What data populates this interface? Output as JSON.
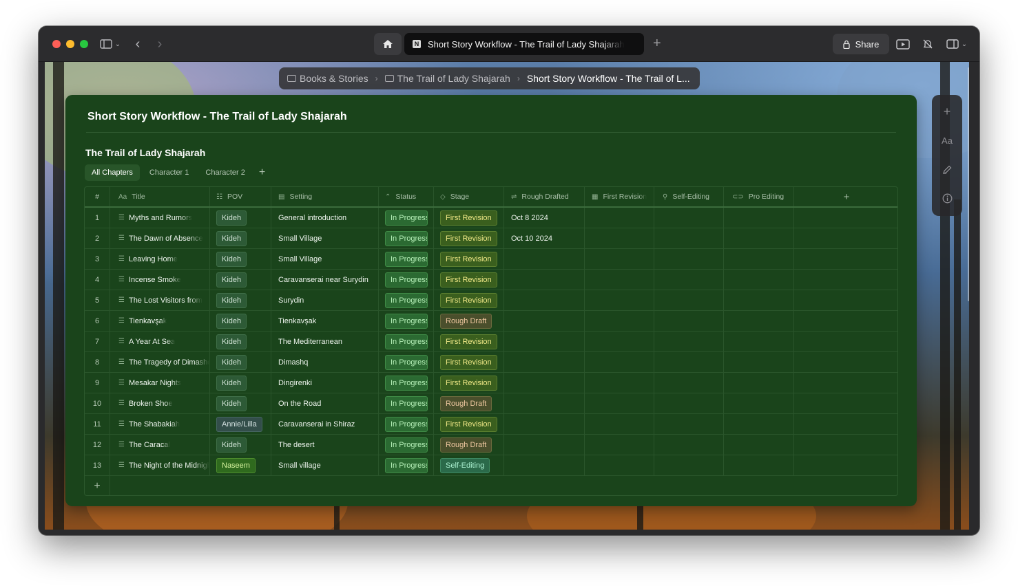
{
  "browser": {
    "tab_title": "Short Story Workflow - The Trail of Lady Shajarah",
    "share_label": "Share"
  },
  "breadcrumb": [
    "Books & Stories",
    "The Trail of Lady Shajarah",
    "Short Story Workflow - The Trail of L..."
  ],
  "page": {
    "title": "Short Story Workflow - The Trail of Lady Shajarah",
    "database_title": "The Trail of Lady Shajarah"
  },
  "views": [
    "All Chapters",
    "Character 1",
    "Character 2"
  ],
  "columns": {
    "num": "#",
    "title": "Title",
    "title_icon": "Aa",
    "pov": "POV",
    "setting": "Setting",
    "status": "Status",
    "stage": "Stage",
    "rough": "Rough Drafted",
    "first": "First Revision",
    "self": "Self-Editing",
    "pro": "Pro Editing"
  },
  "rail": {
    "text_label": "Aa"
  },
  "rows": [
    {
      "num": "1",
      "title": "Myths and Rumors",
      "pov": "Kideh",
      "setting": "General introduction",
      "status": "In Progress",
      "stage": "First Revision",
      "rough": "Oct 8 2024"
    },
    {
      "num": "2",
      "title": "The Dawn of Absence",
      "pov": "Kideh",
      "setting": "Small Village",
      "status": "In Progress",
      "stage": "First Revision",
      "rough": "Oct 10 2024"
    },
    {
      "num": "3",
      "title": "Leaving Home",
      "pov": "Kideh",
      "setting": "Small Village",
      "status": "In Progress",
      "stage": "First Revision",
      "rough": ""
    },
    {
      "num": "4",
      "title": "Incense Smoke",
      "pov": "Kideh",
      "setting": "Caravanserai near Surydin",
      "status": "In Progress",
      "stage": "First Revision",
      "rough": ""
    },
    {
      "num": "5",
      "title": "The Lost Visitors from",
      "pov": "Kideh",
      "setting": "Surydin",
      "status": "In Progress",
      "stage": "First Revision",
      "rough": ""
    },
    {
      "num": "6",
      "title": "Tienkavşak",
      "pov": "Kideh",
      "setting": "Tienkavşak",
      "status": "In Progress",
      "stage": "Rough Draft",
      "rough": ""
    },
    {
      "num": "7",
      "title": "A Year At Sea",
      "pov": "Kideh",
      "setting": "The Mediterranean",
      "status": "In Progress",
      "stage": "First Revision",
      "rough": ""
    },
    {
      "num": "8",
      "title": "The Tragedy of Dimashq",
      "pov": "Kideh",
      "setting": "Dimashq",
      "status": "In Progress",
      "stage": "First Revision",
      "rough": ""
    },
    {
      "num": "9",
      "title": "Mesakar Nights",
      "pov": "Kideh",
      "setting": "Dingirenki",
      "status": "In Progress",
      "stage": "First Revision",
      "rough": ""
    },
    {
      "num": "10",
      "title": "Broken Shoe",
      "pov": "Kideh",
      "setting": "On the Road",
      "status": "In Progress",
      "stage": "Rough Draft",
      "rough": ""
    },
    {
      "num": "11",
      "title": "The Shabakiah",
      "pov": "Annie/Lilla",
      "setting": "Caravanserai in Shiraz",
      "status": "In Progress",
      "stage": "First Revision",
      "rough": ""
    },
    {
      "num": "12",
      "title": "The Caracal",
      "pov": "Kideh",
      "setting": "The desert",
      "status": "In Progress",
      "stage": "Rough Draft",
      "rough": ""
    },
    {
      "num": "13",
      "title": "The Night of the Midnight",
      "pov": "Naseem",
      "setting": "Small village",
      "status": "In Progress",
      "stage": "Self-Editing",
      "rough": ""
    }
  ],
  "colors": {
    "card_bg": "#1a441b",
    "tag_first": "#3a5f1e",
    "tag_rough": "#4a4f2c",
    "tag_self": "#2b6a4a",
    "tag_status": "#2b6a32"
  }
}
